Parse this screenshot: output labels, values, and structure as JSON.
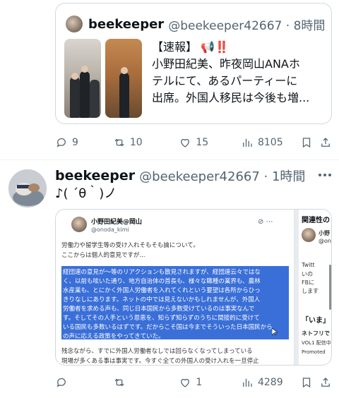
{
  "quoted": {
    "name": "beekeeper",
    "handle_time": "@beekeeper42667 · 8時間",
    "text_lines": [
      "【速報】 📢‼️",
      "小野田紀美、昨夜岡山ANAホ",
      "テルにて、あるパーティーに",
      "出席。外国人移民は今後も増..."
    ]
  },
  "quoted_actions": {
    "reply_count": "9",
    "retweet_count": "10",
    "like_count": "15",
    "view_count": "8105"
  },
  "tweet": {
    "name": "beekeeper",
    "handle_time": "@beekeeper42667 · 1時間",
    "text": "♪( ´θ｀)ノ"
  },
  "embedded": {
    "name": "小野田紀美@岡山",
    "handle": "@onoda_kimi",
    "intro_lines": [
      "労働力や留学生等の受け入れそもそも論について。",
      "ここからは個人的意見ですが..."
    ],
    "selected_lines": [
      "経団連の意見が〜等のリアクションも散見されますが、経団連云々ではな",
      "く、以前も呟いた通り、地方自治体の首長も、様々な職種の業界も、農林",
      "水産業も、とにかく外国人労働者を入れてくれという要望は各所からひっ",
      "きりなしにあります。ネットの中では見えないかもしれませんが、外国人",
      "労働者を求める声も、同じ日本国民から多数受けているのは事実なんで",
      "す。そしてその人手という恩恵を、知らず知らずのうちに間接的に受けて",
      "いる国民も多数いるはずです。だからこそ国は今までそういった日本国民から",
      "の声に応える政策をやってきていた。"
    ],
    "after_lines": [
      "残念ながら、すでに外国人労働者なしでは回らなくなってしまっている",
      "現場が多くある事は事実です。今すぐ全ての外国人の受け入れを一旦停止"
    ],
    "side_lines": [
      "関連性の",
      "小野",
      "@on",
      "Twitt",
      "いの",
      "FBに",
      "します",
      "「いま」",
      "ネトフリで",
      "VOL1 配信中",
      "Promoted"
    ]
  },
  "main_actions": {
    "reply_count": "",
    "retweet_count": "",
    "like_count": "1",
    "view_count": "4289"
  }
}
